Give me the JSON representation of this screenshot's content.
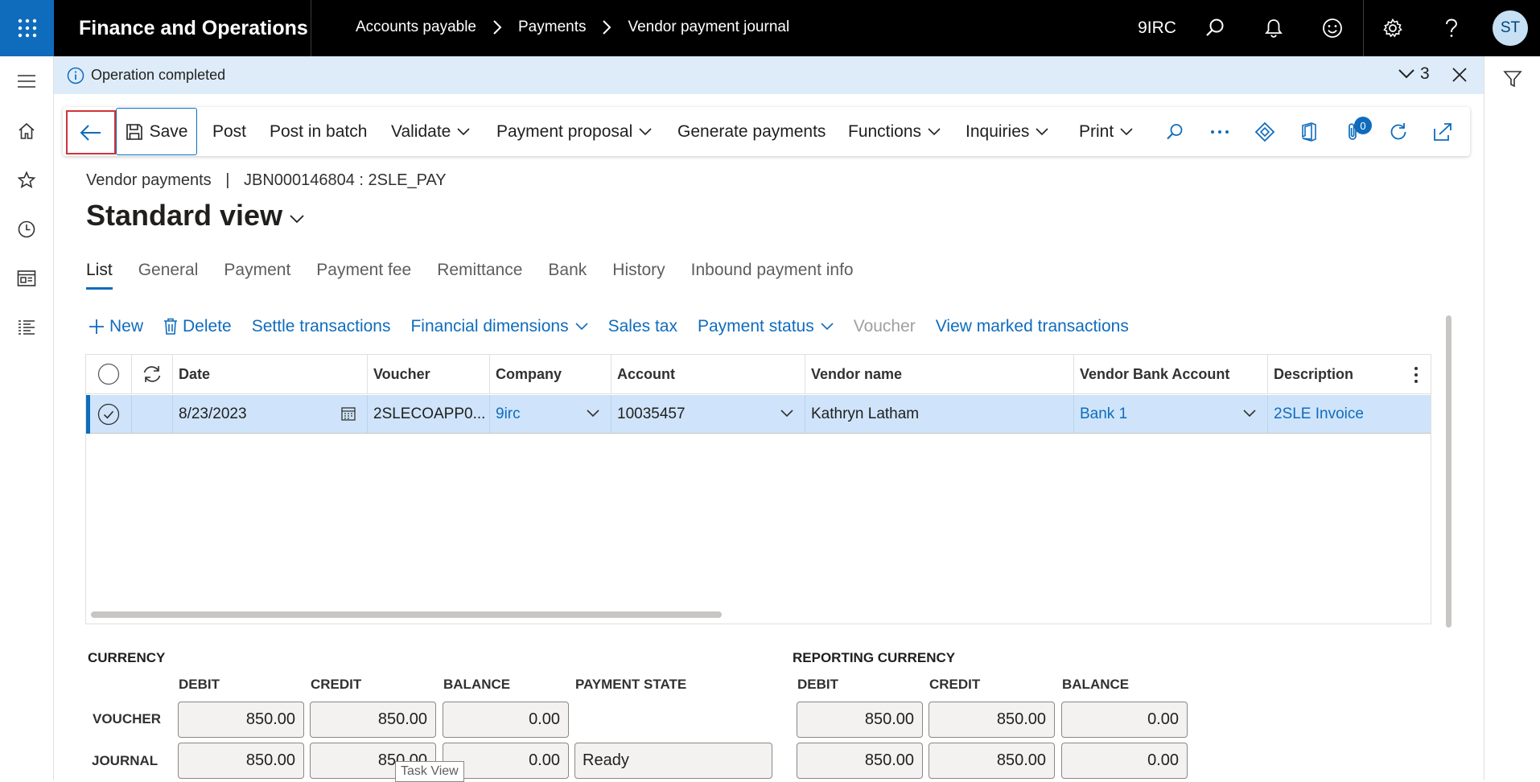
{
  "app": {
    "title": "Finance and Operations",
    "company": "9IRC",
    "user_initials": "ST"
  },
  "breadcrumb": [
    "Accounts payable",
    "Payments",
    "Vendor payment journal"
  ],
  "message": {
    "text": "Operation completed",
    "count": "3"
  },
  "actions": {
    "save": "Save",
    "post": "Post",
    "post_in_batch": "Post in batch",
    "validate": "Validate",
    "payment_proposal": "Payment proposal",
    "generate_payments": "Generate payments",
    "functions": "Functions",
    "inquiries": "Inquiries",
    "print": "Print",
    "attachments_count": "0"
  },
  "page": {
    "caption_left": "Vendor payments",
    "caption_sep": "|",
    "caption_right": "JBN000146804 : 2SLE_PAY",
    "view": "Standard view"
  },
  "tabs": [
    "List",
    "General",
    "Payment",
    "Payment fee",
    "Remittance",
    "Bank",
    "History",
    "Inbound payment info"
  ],
  "grid_toolbar": {
    "new": "New",
    "delete": "Delete",
    "settle": "Settle transactions",
    "financial_dimensions": "Financial dimensions",
    "sales_tax": "Sales tax",
    "payment_status": "Payment status",
    "voucher": "Voucher",
    "view_marked": "View marked transactions"
  },
  "grid": {
    "columns": [
      "Date",
      "Voucher",
      "Company",
      "Account",
      "Vendor name",
      "Vendor Bank Account",
      "Description"
    ],
    "rows": [
      {
        "date": "8/23/2023",
        "voucher": "2SLECOAPP0...",
        "company": "9irc",
        "account": "10035457",
        "vendor_name": "Kathryn Latham",
        "bank_account": "Bank 1",
        "description": "2SLE Invoice"
      }
    ]
  },
  "totals": {
    "currency_header": "CURRENCY",
    "reporting_header": "REPORTING CURRENCY",
    "col_debit": "DEBIT",
    "col_credit": "CREDIT",
    "col_balance": "BALANCE",
    "col_payment_state": "PAYMENT STATE",
    "row_voucher": "VOUCHER",
    "row_journal": "JOURNAL",
    "voucher": {
      "debit": "850.00",
      "credit": "850.00",
      "balance": "0.00",
      "r_debit": "850.00",
      "r_credit": "850.00",
      "r_balance": "0.00"
    },
    "journal": {
      "debit": "850.00",
      "credit": "850.00",
      "balance": "0.00",
      "payment_state": "Ready",
      "r_debit": "850.00",
      "r_credit": "850.00",
      "r_balance": "0.00"
    }
  },
  "tooltip": "Task View"
}
